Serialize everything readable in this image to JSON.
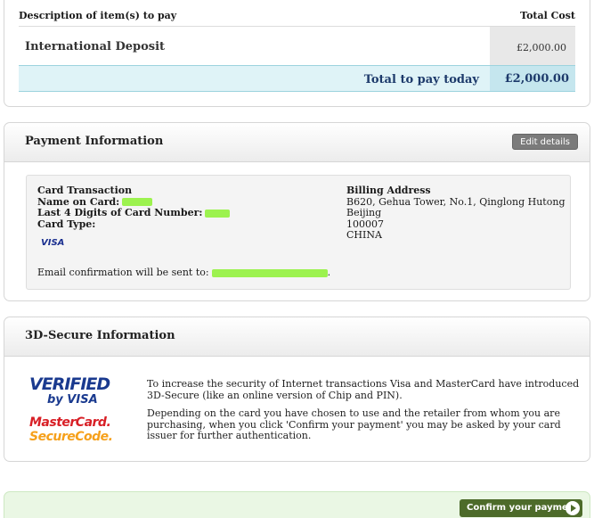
{
  "summary": {
    "col_description": "Description of item(s) to pay",
    "col_total": "Total Cost",
    "item_description": "International Deposit",
    "item_cost": "£2,000.00",
    "total_label": "Total to pay today",
    "total_value": "£2,000.00"
  },
  "payment": {
    "title": "Payment Information",
    "edit_label": "Edit details",
    "card_transaction": "Card Transaction",
    "name_label": "Name on Card:",
    "last4_label": "Last 4 Digits of Card Number:",
    "card_type_label": "Card Type:",
    "card_type_value": "VISA",
    "billing_title": "Billing Address",
    "address": [
      "B620, Gehua Tower, No.1, Qinglong Hutong",
      "Beijing",
      "100007",
      "CHINA"
    ],
    "email_text": "Email confirmation will be sent to:",
    "email_suffix": "."
  },
  "secure": {
    "title": "3D-Secure Information",
    "logo_vbv_line1": "VERIFIED",
    "logo_vbv_line2": "by VISA",
    "logo_mc_line1": "MasterCard.",
    "logo_mc_line2": "SecureCode.",
    "paragraph1": "To increase the security of Internet transactions Visa and MasterCard have introduced 3D-Secure (like an online version of Chip and PIN).",
    "paragraph2": "Depending on the card you have chosen to use and the retailer from whom you are purchasing, when you click 'Confirm your payment' you may be asked by your card issuer for further authentication."
  },
  "confirm": {
    "label": "Confirm your payment"
  },
  "colors": {
    "redaction": "#9cf24f",
    "confirm_button": "#4d6b2a",
    "total_text": "#1d3a6b"
  }
}
